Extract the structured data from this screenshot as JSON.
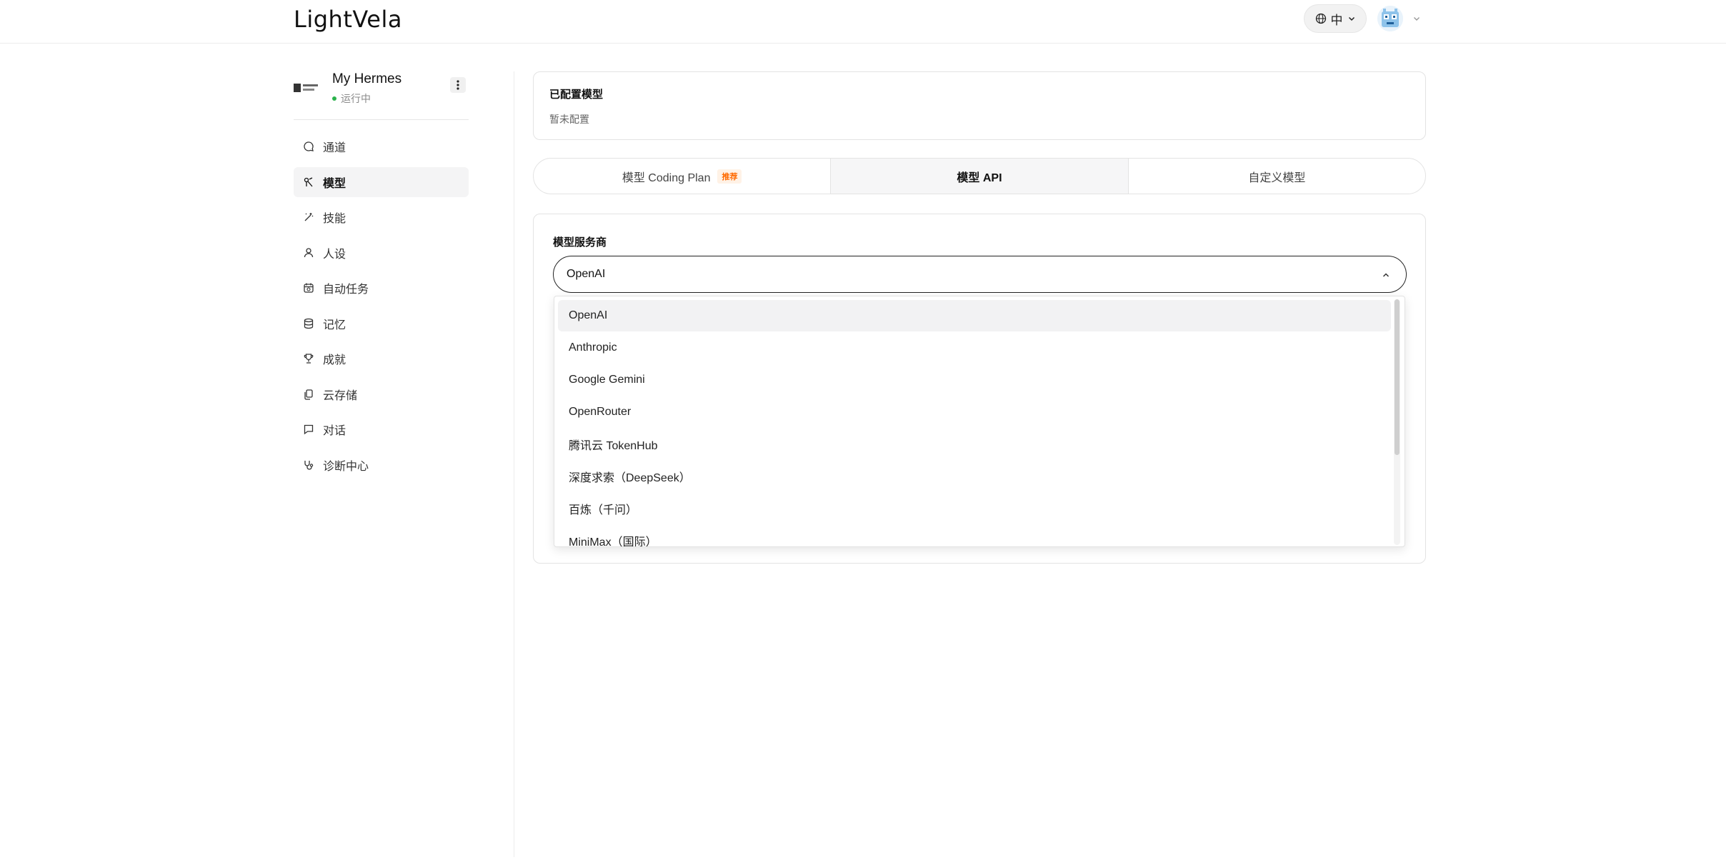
{
  "header": {
    "logo": "LightVela",
    "language": "中"
  },
  "sidebar": {
    "agent": {
      "name": "My Hermes",
      "status": "运行中"
    },
    "items": [
      {
        "label": "通道",
        "icon": "chat-bubble-icon"
      },
      {
        "label": "模型",
        "icon": "model-icon",
        "active": true
      },
      {
        "label": "技能",
        "icon": "magic-wand-icon"
      },
      {
        "label": "人设",
        "icon": "person-icon"
      },
      {
        "label": "自动任务",
        "icon": "calendar-clock-icon"
      },
      {
        "label": "记忆",
        "icon": "database-icon"
      },
      {
        "label": "成就",
        "icon": "trophy-icon"
      },
      {
        "label": "云存储",
        "icon": "cloud-files-icon"
      },
      {
        "label": "对话",
        "icon": "message-square-icon"
      },
      {
        "label": "诊断中心",
        "icon": "stethoscope-icon"
      }
    ]
  },
  "configured": {
    "title": "已配置模型",
    "empty": "暂未配置"
  },
  "tabs": [
    {
      "label": "模型 Coding Plan",
      "badge": "推荐"
    },
    {
      "label": "模型 API",
      "active": true
    },
    {
      "label": "自定义模型"
    }
  ],
  "provider": {
    "label": "模型服务商",
    "selected": "OpenAI",
    "options": [
      "OpenAI",
      "Anthropic",
      "Google Gemini",
      "OpenRouter",
      "腾讯云 TokenHub",
      "深度求索（DeepSeek）",
      "百炼（千问）",
      "MiniMax（国际）"
    ]
  },
  "colors": {
    "accent": "#111111",
    "badge": "#ff6a00",
    "status_online": "#2bb24c"
  }
}
